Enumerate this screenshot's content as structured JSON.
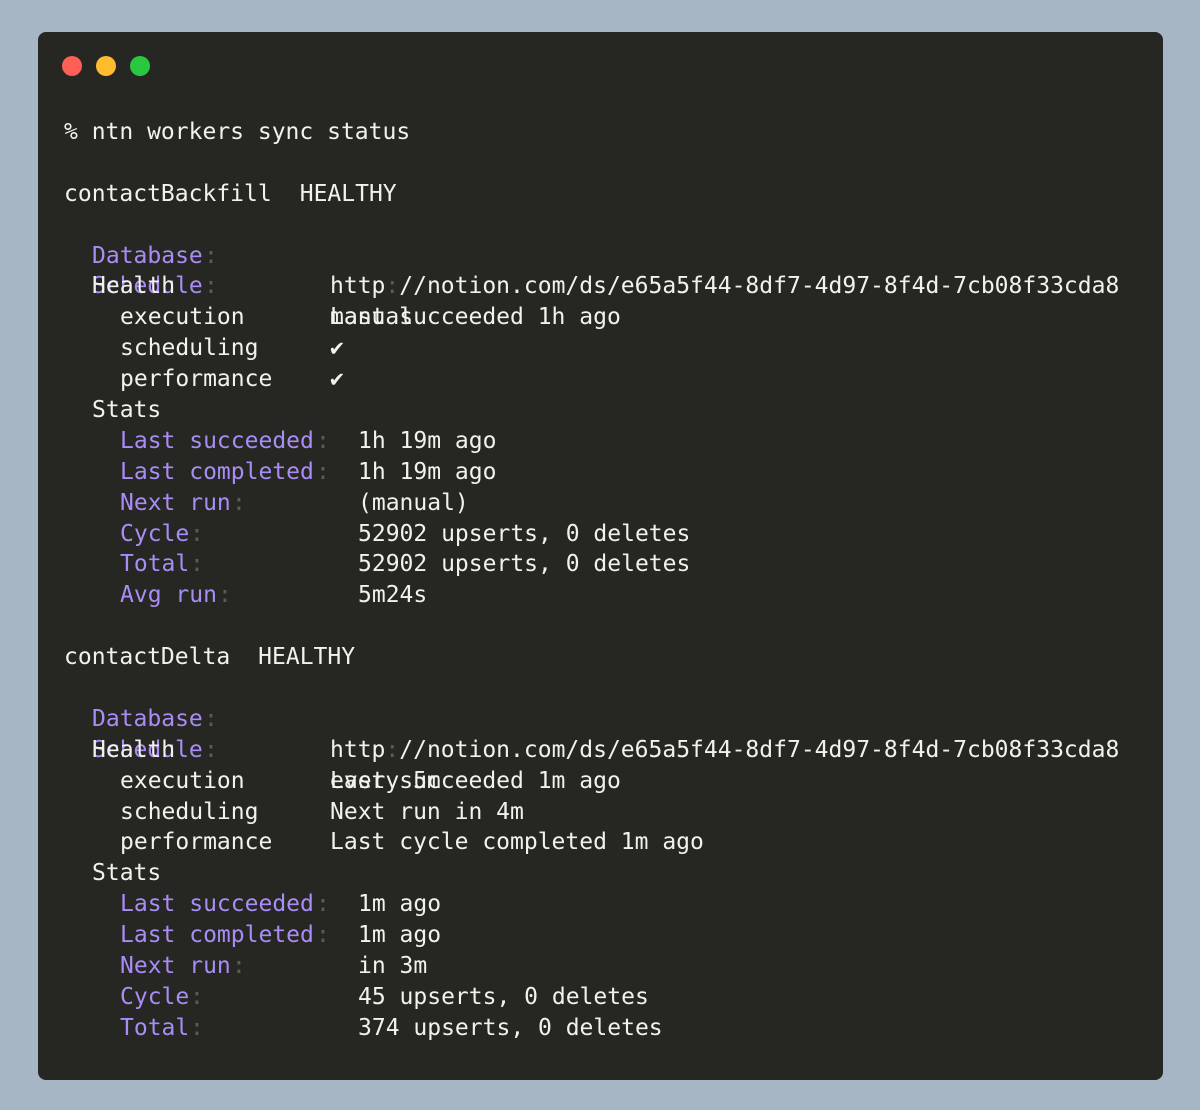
{
  "window": {
    "dots": {
      "close": "#fe5f57",
      "minimize": "#febc2e",
      "zoom": "#28c840"
    }
  },
  "colors": {
    "background": "#a7b6c4",
    "terminal_bg": "#262723",
    "text": "#f2f2ed",
    "key": "#a98cf5",
    "colon": "#595b54"
  },
  "command": "% ntn workers sync status",
  "workers": [
    {
      "name": "contactBackfill",
      "status": "HEALTHY",
      "database_label": "Database",
      "database_proto": "http",
      "database_rest": "//notion.com/ds/e65a5f44-8df7-4d97-8f4d-7cb08f33cda8",
      "schedule_label": "Schedule",
      "schedule": "manual",
      "health_label": "Health",
      "health": [
        {
          "label": "execution",
          "value": "Last succeeded 1h ago"
        },
        {
          "label": "scheduling",
          "value": "✔"
        },
        {
          "label": "performance",
          "value": "✔"
        }
      ],
      "stats_label": "Stats",
      "stats": [
        {
          "label": "Last succeeded",
          "value": "1h 19m ago"
        },
        {
          "label": "Last completed",
          "value": "1h 19m ago"
        },
        {
          "label": "Next run",
          "value": "(manual)"
        },
        {
          "label": "Cycle",
          "value": "52902 upserts, 0 deletes"
        },
        {
          "label": "Total",
          "value": "52902 upserts, 0 deletes"
        },
        {
          "label": "Avg run",
          "value": "5m24s"
        }
      ]
    },
    {
      "name": "contactDelta",
      "status": "HEALTHY",
      "database_label": "Database",
      "database_proto": "http",
      "database_rest": "//notion.com/ds/e65a5f44-8df7-4d97-8f4d-7cb08f33cda8",
      "schedule_label": "Schedule",
      "schedule": "every 5m",
      "health_label": "Health",
      "health": [
        {
          "label": "execution",
          "value": "Last succeeded 1m ago"
        },
        {
          "label": "scheduling",
          "value": "Next run in 4m"
        },
        {
          "label": "performance",
          "value": "Last cycle completed 1m ago"
        }
      ],
      "stats_label": "Stats",
      "stats": [
        {
          "label": "Last succeeded",
          "value": "1m ago"
        },
        {
          "label": "Last completed",
          "value": "1m ago"
        },
        {
          "label": "Next run",
          "value": "in 3m"
        },
        {
          "label": "Cycle",
          "value": "45 upserts, 0 deletes"
        },
        {
          "label": "Total",
          "value": "374 upserts, 0 deletes"
        }
      ]
    }
  ]
}
